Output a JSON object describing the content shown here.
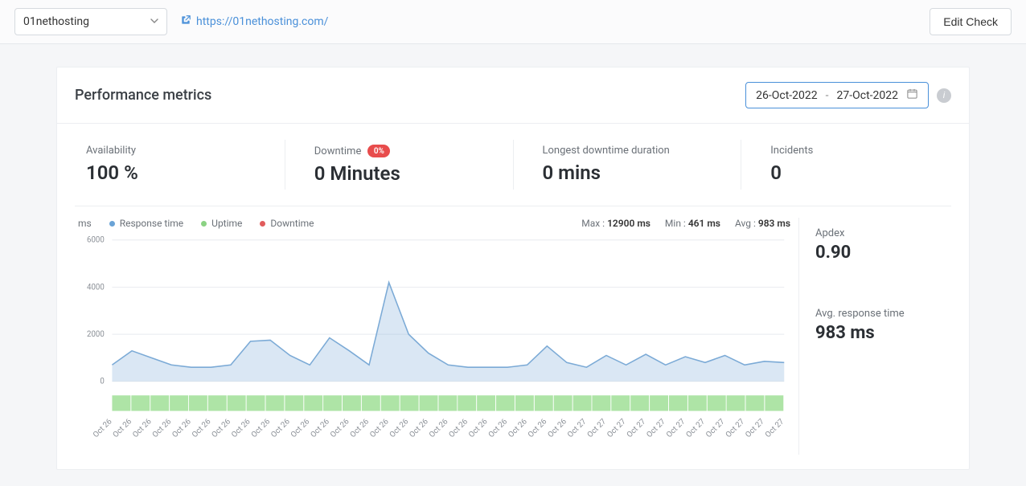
{
  "topbar": {
    "site_name": "01nethosting",
    "site_url": "https://01nethosting.com/",
    "edit_btn": "Edit Check"
  },
  "panel": {
    "title": "Performance metrics",
    "date_from": "26-Oct-2022",
    "date_sep": "-",
    "date_to": "27-Oct-2022"
  },
  "metrics": {
    "availability_label": "Availability",
    "availability_value": "100 %",
    "downtime_label": "Downtime",
    "downtime_badge": "0%",
    "downtime_value": "0 Minutes",
    "longest_label": "Longest downtime duration",
    "longest_value": "0 mins",
    "incidents_label": "Incidents",
    "incidents_value": "0"
  },
  "chart": {
    "y_unit": "ms",
    "legend_response": "Response time",
    "legend_uptime": "Uptime",
    "legend_downtime": "Downtime",
    "stat_max_label": "Max : ",
    "stat_max_value": "12900 ms",
    "stat_min_label": "Min : ",
    "stat_min_value": "461 ms",
    "stat_avg_label": "Avg : ",
    "stat_avg_value": "983 ms",
    "colors": {
      "response": "#6aa3d6",
      "uptime": "#8bd283",
      "downtime": "#e15c5c"
    },
    "y_ticks": [
      "0",
      "2000",
      "4000",
      "6000"
    ]
  },
  "side": {
    "apdex_label": "Apdex",
    "apdex_value": "0.90",
    "art_label": "Avg. response time",
    "art_value": "983 ms"
  },
  "chart_data": {
    "type": "line",
    "ylabel": "ms",
    "ylim": [
      0,
      6000
    ],
    "categories": [
      "Oct 26",
      "Oct 26",
      "Oct 26",
      "Oct 26",
      "Oct 26",
      "Oct 26",
      "Oct 26",
      "Oct 26",
      "Oct 26",
      "Oct 26",
      "Oct 26",
      "Oct 26",
      "Oct 26",
      "Oct 26",
      "Oct 26",
      "Oct 26",
      "Oct 26",
      "Oct 26",
      "Oct 26",
      "Oct 26",
      "Oct 26",
      "Oct 26",
      "Oct 26",
      "Oct 26",
      "Oct 27",
      "Oct 27",
      "Oct 27",
      "Oct 27",
      "Oct 27",
      "Oct 27",
      "Oct 27",
      "Oct 27",
      "Oct 27",
      "Oct 27",
      "Oct 27"
    ],
    "series": [
      {
        "name": "Response time",
        "values": [
          700,
          1300,
          1000,
          700,
          600,
          600,
          700,
          1700,
          1750,
          1100,
          700,
          1850,
          1300,
          700,
          4200,
          2000,
          1200,
          700,
          600,
          600,
          600,
          700,
          1500,
          800,
          600,
          1100,
          700,
          1150,
          700,
          1050,
          800,
          1100,
          700,
          850,
          800
        ]
      }
    ]
  }
}
